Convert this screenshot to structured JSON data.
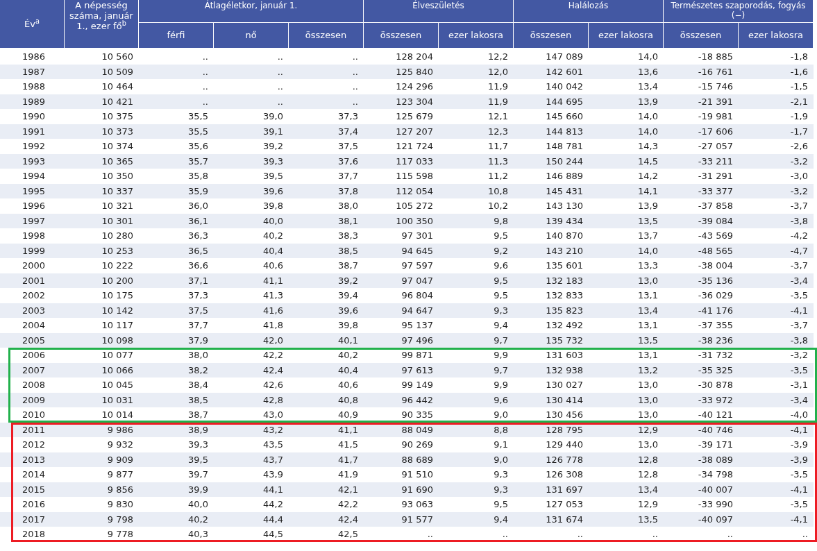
{
  "header": {
    "year": "Év$^{a}$",
    "population": "A népesség száma, január 1., ezer fő$^{b}$",
    "groups": [
      {
        "label": "Átlagéletkor, január 1.",
        "columns": [
          "férfi",
          "nő",
          "összesen"
        ]
      },
      {
        "label": "Élveszületés",
        "columns": [
          "összesen",
          "ezer lakosra"
        ]
      },
      {
        "label": "Halálozás",
        "columns": [
          "összesen",
          "ezer lakosra"
        ]
      },
      {
        "label": "Természetes szaporodás, fogyás (−)",
        "columns": [
          "összesen",
          "ezer lakosra"
        ]
      }
    ]
  },
  "row_groups": [
    {
      "kind": "plain",
      "rows": [
        [
          "1986",
          "10 560",
          "..",
          "..",
          "..",
          "128 204",
          "12,2",
          "147 089",
          "14,0",
          "-18 885",
          "-1,8"
        ],
        [
          "1987",
          "10 509",
          "..",
          "..",
          "..",
          "125 840",
          "12,0",
          "142 601",
          "13,6",
          "-16 761",
          "-1,6"
        ],
        [
          "1988",
          "10 464",
          "..",
          "..",
          "..",
          "124 296",
          "11,9",
          "140 042",
          "13,4",
          "-15 746",
          "-1,5"
        ],
        [
          "1989",
          "10 421",
          "..",
          "..",
          "..",
          "123 304",
          "11,9",
          "144 695",
          "13,9",
          "-21 391",
          "-2,1"
        ],
        [
          "1990",
          "10 375",
          "35,5",
          "39,0",
          "37,3",
          "125 679",
          "12,1",
          "145 660",
          "14,0",
          "-19 981",
          "-1,9"
        ],
        [
          "1991",
          "10 373",
          "35,5",
          "39,1",
          "37,4",
          "127 207",
          "12,3",
          "144 813",
          "14,0",
          "-17 606",
          "-1,7"
        ],
        [
          "1992",
          "10 374",
          "35,6",
          "39,2",
          "37,5",
          "121 724",
          "11,7",
          "148 781",
          "14,3",
          "-27 057",
          "-2,6"
        ],
        [
          "1993",
          "10 365",
          "35,7",
          "39,3",
          "37,6",
          "117 033",
          "11,3",
          "150 244",
          "14,5",
          "-33 211",
          "-3,2"
        ],
        [
          "1994",
          "10 350",
          "35,8",
          "39,5",
          "37,7",
          "115 598",
          "11,2",
          "146 889",
          "14,2",
          "-31 291",
          "-3,0"
        ],
        [
          "1995",
          "10 337",
          "35,9",
          "39,6",
          "37,8",
          "112 054",
          "10,8",
          "145 431",
          "14,1",
          "-33 377",
          "-3,2"
        ],
        [
          "1996",
          "10 321",
          "36,0",
          "39,8",
          "38,0",
          "105 272",
          "10,2",
          "143 130",
          "13,9",
          "-37 858",
          "-3,7"
        ],
        [
          "1997",
          "10 301",
          "36,1",
          "40,0",
          "38,1",
          "100 350",
          "9,8",
          "139 434",
          "13,5",
          "-39 084",
          "-3,8"
        ],
        [
          "1998",
          "10 280",
          "36,3",
          "40,2",
          "38,3",
          "97 301",
          "9,5",
          "140 870",
          "13,7",
          "-43 569",
          "-4,2"
        ],
        [
          "1999",
          "10 253",
          "36,5",
          "40,4",
          "38,5",
          "94 645",
          "9,2",
          "143 210",
          "14,0",
          "-48 565",
          "-4,7"
        ],
        [
          "2000",
          "10 222",
          "36,6",
          "40,6",
          "38,7",
          "97 597",
          "9,6",
          "135 601",
          "13,3",
          "-38 004",
          "-3,7"
        ],
        [
          "2001",
          "10 200",
          "37,1",
          "41,1",
          "39,2",
          "97 047",
          "9,5",
          "132 183",
          "13,0",
          "-35 136",
          "-3,4"
        ],
        [
          "2002",
          "10 175",
          "37,3",
          "41,3",
          "39,4",
          "96 804",
          "9,5",
          "132 833",
          "13,1",
          "-36 029",
          "-3,5"
        ],
        [
          "2003",
          "10 142",
          "37,5",
          "41,6",
          "39,6",
          "94 647",
          "9,3",
          "135 823",
          "13,4",
          "-41 176",
          "-4,1"
        ],
        [
          "2004",
          "10 117",
          "37,7",
          "41,8",
          "39,8",
          "95 137",
          "9,4",
          "132 492",
          "13,1",
          "-37 355",
          "-3,7"
        ],
        [
          "2005",
          "10 098",
          "37,9",
          "42,0",
          "40,1",
          "97 496",
          "9,7",
          "135 732",
          "13,5",
          "-38 236",
          "-3,8"
        ]
      ]
    },
    {
      "kind": "outlined",
      "color": "#22b14c",
      "rows": [
        [
          "2006",
          "10 077",
          "38,0",
          "42,2",
          "40,2",
          "99 871",
          "9,9",
          "131 603",
          "13,1",
          "-31 732",
          "-3,2"
        ],
        [
          "2007",
          "10 066",
          "38,2",
          "42,4",
          "40,4",
          "97 613",
          "9,7",
          "132 938",
          "13,2",
          "-35 325",
          "-3,5"
        ],
        [
          "2008",
          "10 045",
          "38,4",
          "42,6",
          "40,6",
          "99 149",
          "9,9",
          "130 027",
          "13,0",
          "-30 878",
          "-3,1"
        ],
        [
          "2009",
          "10 031",
          "38,5",
          "42,8",
          "40,8",
          "96 442",
          "9,6",
          "130 414",
          "13,0",
          "-33 972",
          "-3,4"
        ],
        [
          "2010",
          "10 014",
          "38,7",
          "43,0",
          "40,9",
          "90 335",
          "9,0",
          "130 456",
          "13,0",
          "-40 121",
          "-4,0"
        ]
      ]
    },
    {
      "kind": "outlined",
      "color": "#ed1c24",
      "rows": [
        [
          "2011",
          "9 986",
          "38,9",
          "43,2",
          "41,1",
          "88 049",
          "8,8",
          "128 795",
          "12,9",
          "-40 746",
          "-4,1"
        ],
        [
          "2012",
          "9 932",
          "39,3",
          "43,5",
          "41,5",
          "90 269",
          "9,1",
          "129 440",
          "13,0",
          "-39 171",
          "-3,9"
        ],
        [
          "2013",
          "9 909",
          "39,5",
          "43,7",
          "41,7",
          "88 689",
          "9,0",
          "126 778",
          "12,8",
          "-38 089",
          "-3,9"
        ],
        [
          "2014",
          "9 877",
          "39,7",
          "43,9",
          "41,9",
          "91 510",
          "9,3",
          "126 308",
          "12,8",
          "-34 798",
          "-3,5"
        ],
        [
          "2015",
          "9 856",
          "39,9",
          "44,1",
          "42,1",
          "91 690",
          "9,3",
          "131 697",
          "13,4",
          "-40 007",
          "-4,1"
        ],
        [
          "2016",
          "9 830",
          "40,0",
          "44,2",
          "42,2",
          "93 063",
          "9,5",
          "127 053",
          "12,9",
          "-33 990",
          "-3,5"
        ],
        [
          "2017",
          "9 798",
          "40,2",
          "44,4",
          "42,4",
          "91 577",
          "9,4",
          "131 674",
          "13,5",
          "-40 097",
          "-4,1"
        ],
        [
          "2018",
          "9 778",
          "40,3",
          "44,5",
          "42,5",
          "..",
          "..",
          "..",
          "..",
          "..",
          ".."
        ]
      ]
    }
  ]
}
